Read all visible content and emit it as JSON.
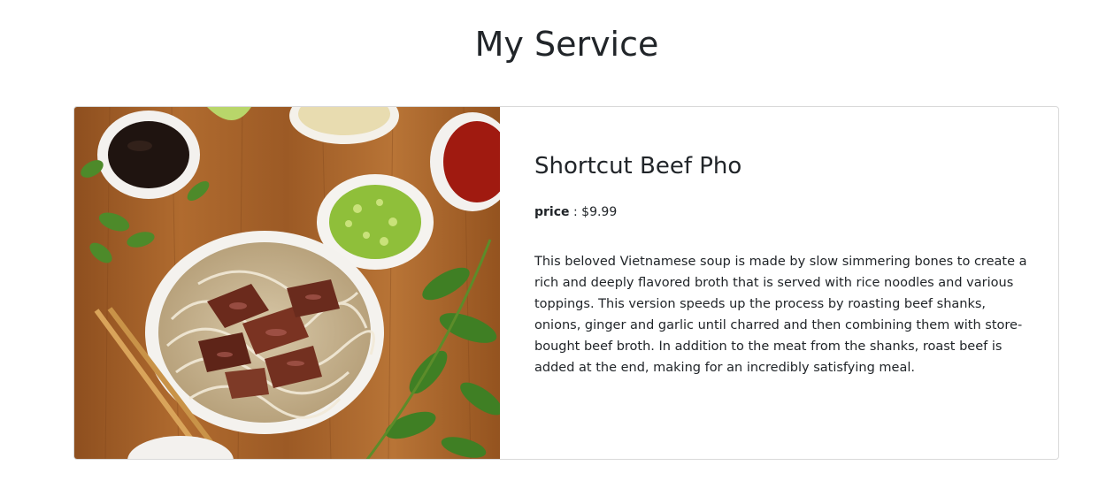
{
  "page": {
    "title": "My Service"
  },
  "service": {
    "name": "Shortcut Beef Pho",
    "price_label": "price",
    "price_separator": " : ",
    "price_value": "$9.99",
    "description": "This beloved Vietnamese soup is made by slow simmering bones to create a rich and deeply flavored broth that is served with rice noodles and various toppings. This version speeds up the process by roasting beef shanks, onions, ginger and garlic until charred and then combining them with store-bought beef broth. In addition to the meat from the shanks, roast beef is added at the end, making for an incredibly satisfying meal.",
    "image_icon": "beef-pho-photo"
  },
  "colors": {
    "text": "#212529",
    "card_border": "#d9d9d9",
    "wood": "#a0612a"
  }
}
